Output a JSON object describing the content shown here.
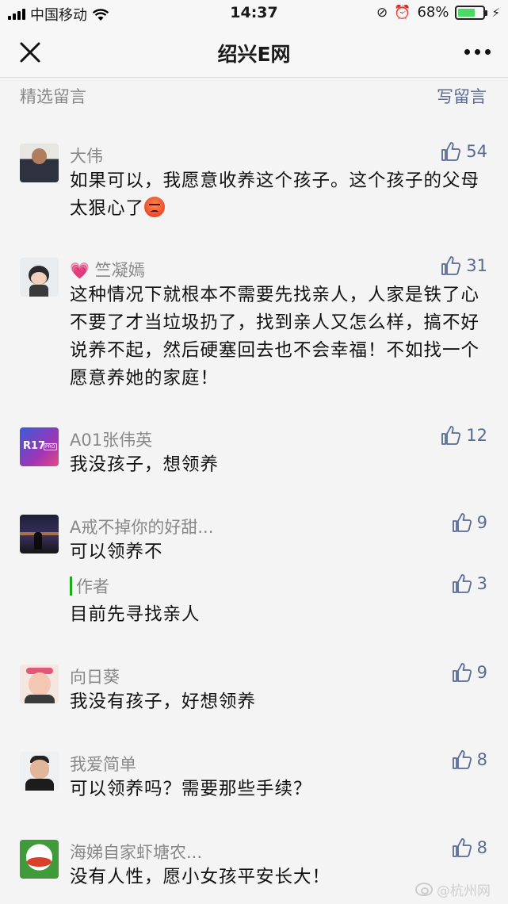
{
  "status_bar": {
    "carrier": "中国移动",
    "time": "14:37",
    "battery_percent": "68%",
    "battery_level": 0.68
  },
  "nav": {
    "title": "绍兴E网",
    "close_icon": "close-icon",
    "more_icon": "more-icon"
  },
  "section": {
    "title": "精选留言",
    "write": "写留言"
  },
  "comments": [
    {
      "name": "大伟",
      "likes": "54",
      "text": "如果可以，我愿意收养这个孩子。这个孩子的父母太狠心了",
      "emoji": "angry-face-icon"
    },
    {
      "name": "竺凝嫣",
      "prefix_icon": "heart-icon",
      "likes": "31",
      "text": "这种情况下就根本不需要先找亲人，人家是铁了心不要了才当垃圾扔了，找到亲人又怎么样，搞不好说养不起，然后硬塞回去也不会幸福！不如找一个愿意养她的家庭！"
    },
    {
      "name": "A01张伟英",
      "avatar_text": "R17",
      "avatar_badge": "PRO",
      "likes": "12",
      "text": "我没孩子，想领养"
    },
    {
      "name": "A戒不掉你的好甜...",
      "likes": "9",
      "text": "可以领养不",
      "reply": {
        "label": "作者",
        "likes": "3",
        "text": "目前先寻找亲人"
      }
    },
    {
      "name": "向日葵",
      "likes": "9",
      "text": "我没有孩子，好想领养"
    },
    {
      "name": "我爱简单",
      "likes": "8",
      "text": "可以领养吗？需要那些手续？"
    },
    {
      "name": "海娣自家虾塘农...",
      "likes": "8",
      "text": "没有人性，愿小女孩平安长大！"
    }
  ],
  "watermark": "@杭州网",
  "colors": {
    "link": "#576b95",
    "muted": "#888888",
    "author_bar": "#1aad19",
    "battery": "#4cd964"
  }
}
